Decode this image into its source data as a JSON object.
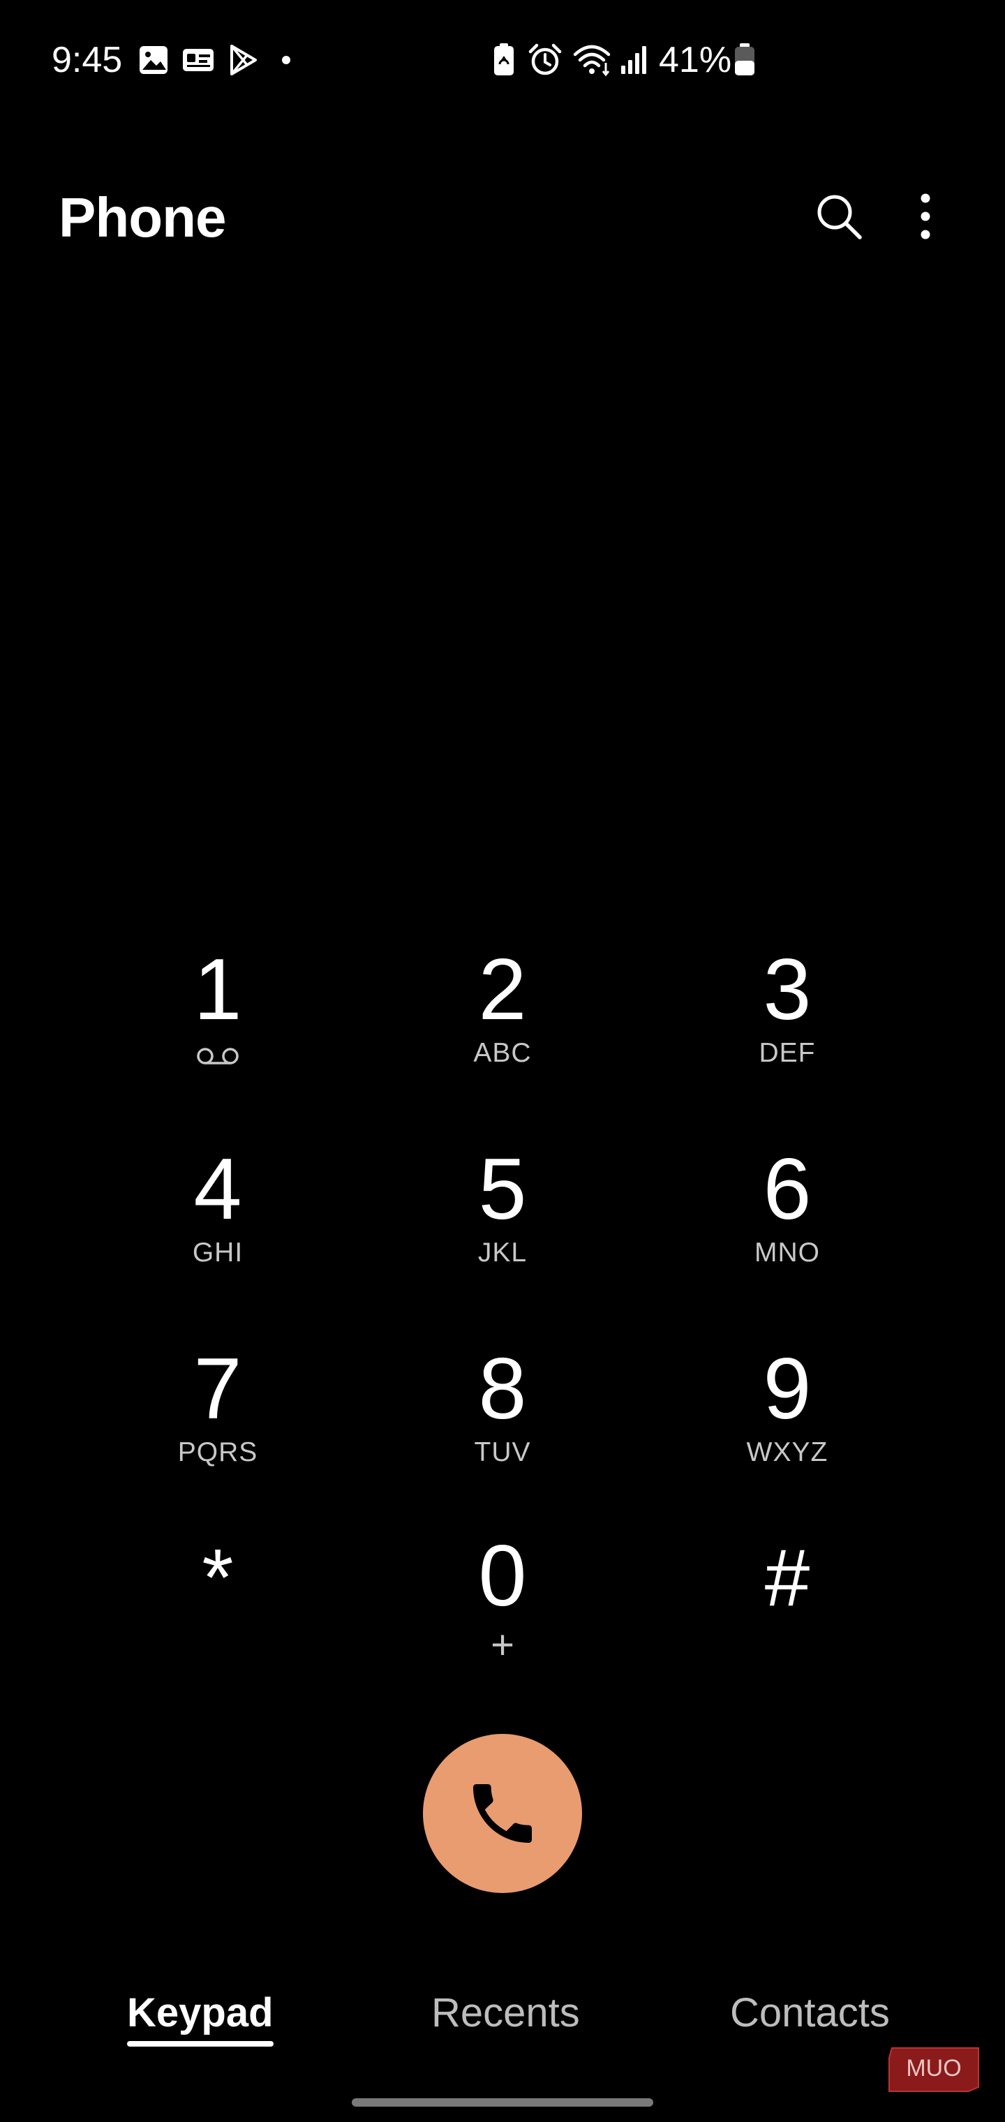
{
  "status_bar": {
    "time": "9:45",
    "battery": "41%",
    "icons_left": [
      "gallery-icon",
      "id-card-icon",
      "play-store-icon",
      "dot-icon"
    ],
    "icons_right": [
      "battery-saver-icon",
      "alarm-icon",
      "wifi-icon",
      "signal-icon",
      "battery-icon"
    ]
  },
  "header": {
    "title": "Phone",
    "actions": [
      "search-icon",
      "more-options-icon"
    ]
  },
  "keypad": {
    "keys": [
      {
        "digit": "1",
        "letters": "",
        "sub_icon": "voicemail-icon"
      },
      {
        "digit": "2",
        "letters": "ABC"
      },
      {
        "digit": "3",
        "letters": "DEF"
      },
      {
        "digit": "4",
        "letters": "GHI"
      },
      {
        "digit": "5",
        "letters": "JKL"
      },
      {
        "digit": "6",
        "letters": "MNO"
      },
      {
        "digit": "7",
        "letters": "PQRS"
      },
      {
        "digit": "8",
        "letters": "TUV"
      },
      {
        "digit": "9",
        "letters": "WXYZ"
      },
      {
        "digit": "*",
        "letters": ""
      },
      {
        "digit": "0",
        "letters": "+"
      },
      {
        "digit": "#",
        "letters": ""
      }
    ]
  },
  "call": {
    "icon": "phone-icon",
    "color": "#E99C70"
  },
  "tabs": [
    {
      "label": "Keypad",
      "active": true
    },
    {
      "label": "Recents",
      "active": false
    },
    {
      "label": "Contacts",
      "active": false
    }
  ],
  "watermark": {
    "text": "MUO",
    "color": "#8B1A1A"
  }
}
